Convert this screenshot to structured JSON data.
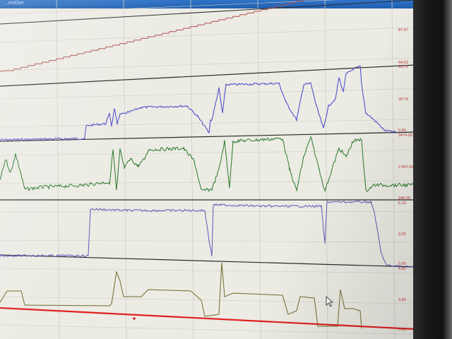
{
  "window": {
    "title": "...mvDyn"
  },
  "colors": {
    "background": "#ecebe4",
    "grid": "#cfcfc4",
    "separator": "#2a2a2a",
    "axis_label": "#c03030",
    "trace_1": "#b05050",
    "trace_2": "#4444cc",
    "trace_3": "#2a7a2a",
    "trace_4": "#6655bb",
    "trace_5": "#6b6b2a",
    "marker_line": "#e02020"
  },
  "panels": [
    {
      "name": "panel-1",
      "labels": [
        "87.97",
        "44.53"
      ]
    },
    {
      "name": "panel-2",
      "labels": [
        "13.73",
        "28.79",
        "0.00"
      ]
    },
    {
      "name": "panel-3",
      "labels": [
        "3474.00",
        "2 507.00",
        "946.00"
      ]
    },
    {
      "name": "panel-4",
      "labels": [
        "6.19",
        "3.25",
        "0.00"
      ]
    },
    {
      "name": "panel-5",
      "labels": [
        "4.82",
        "3.63",
        "0.00"
      ]
    }
  ],
  "cursor": {
    "icon": "arrow-cursor-icon"
  }
}
